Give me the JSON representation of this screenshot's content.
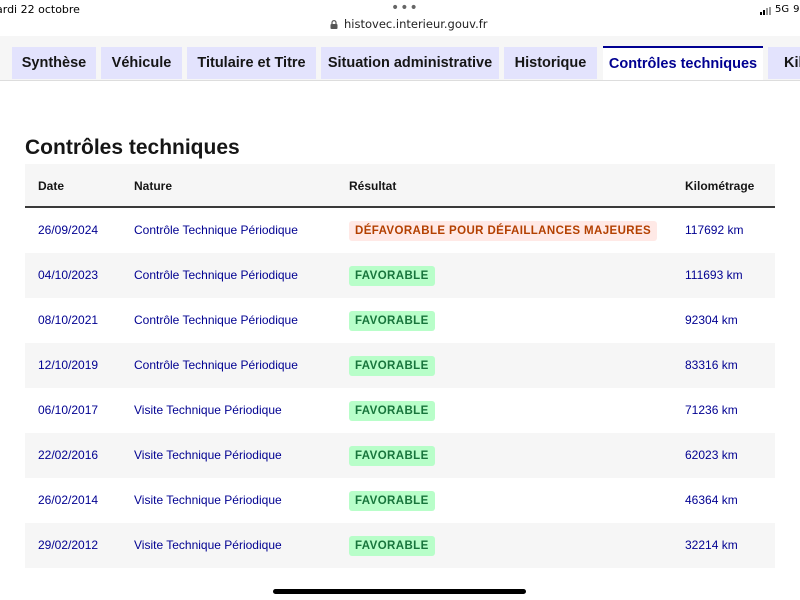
{
  "status_bar": {
    "date": "ardi 22 octobre",
    "url": "histovec.interieur.gouv.fr",
    "network": "5G",
    "battery_text": "9"
  },
  "tabs": [
    {
      "label": "Synthèse",
      "active": false
    },
    {
      "label": "Véhicule",
      "active": false
    },
    {
      "label": "Titulaire et Titre",
      "active": false
    },
    {
      "label": "Situation administrative",
      "active": false
    },
    {
      "label": "Historique",
      "active": false
    },
    {
      "label": "Contrôles techniques",
      "active": true
    },
    {
      "label": "Kilo",
      "active": false
    }
  ],
  "section": {
    "title": "Contrôles techniques"
  },
  "table": {
    "headers": [
      "Date",
      "Nature",
      "Résultat",
      "Kilométrage"
    ],
    "rows": [
      {
        "date": "26/09/2024",
        "nature": "Contrôle Technique Périodique",
        "result": "DÉFAVORABLE POUR DÉFAILLANCES MAJEURES",
        "status": "ko",
        "km": "117692 km"
      },
      {
        "date": "04/10/2023",
        "nature": "Contrôle Technique Périodique",
        "result": "FAVORABLE",
        "status": "ok",
        "km": "111693 km"
      },
      {
        "date": "08/10/2021",
        "nature": "Contrôle Technique Périodique",
        "result": "FAVORABLE",
        "status": "ok",
        "km": "92304 km"
      },
      {
        "date": "12/10/2019",
        "nature": "Contrôle Technique Périodique",
        "result": "FAVORABLE",
        "status": "ok",
        "km": "83316 km"
      },
      {
        "date": "06/10/2017",
        "nature": "Visite Technique Périodique",
        "result": "FAVORABLE",
        "status": "ok",
        "km": "71236 km"
      },
      {
        "date": "22/02/2016",
        "nature": "Visite Technique Périodique",
        "result": "FAVORABLE",
        "status": "ok",
        "km": "62023 km"
      },
      {
        "date": "26/02/2014",
        "nature": "Visite Technique Périodique",
        "result": "FAVORABLE",
        "status": "ok",
        "km": "46364 km"
      },
      {
        "date": "29/02/2012",
        "nature": "Visite Technique Périodique",
        "result": "FAVORABLE",
        "status": "ok",
        "km": "32214 km"
      }
    ]
  },
  "colors": {
    "brand_blue": "#000091",
    "tab_bg": "#e3e3fd",
    "success_bg": "#b8fec9",
    "success_text": "#18753c",
    "error_bg": "#ffe9e6",
    "error_text": "#b34000"
  }
}
